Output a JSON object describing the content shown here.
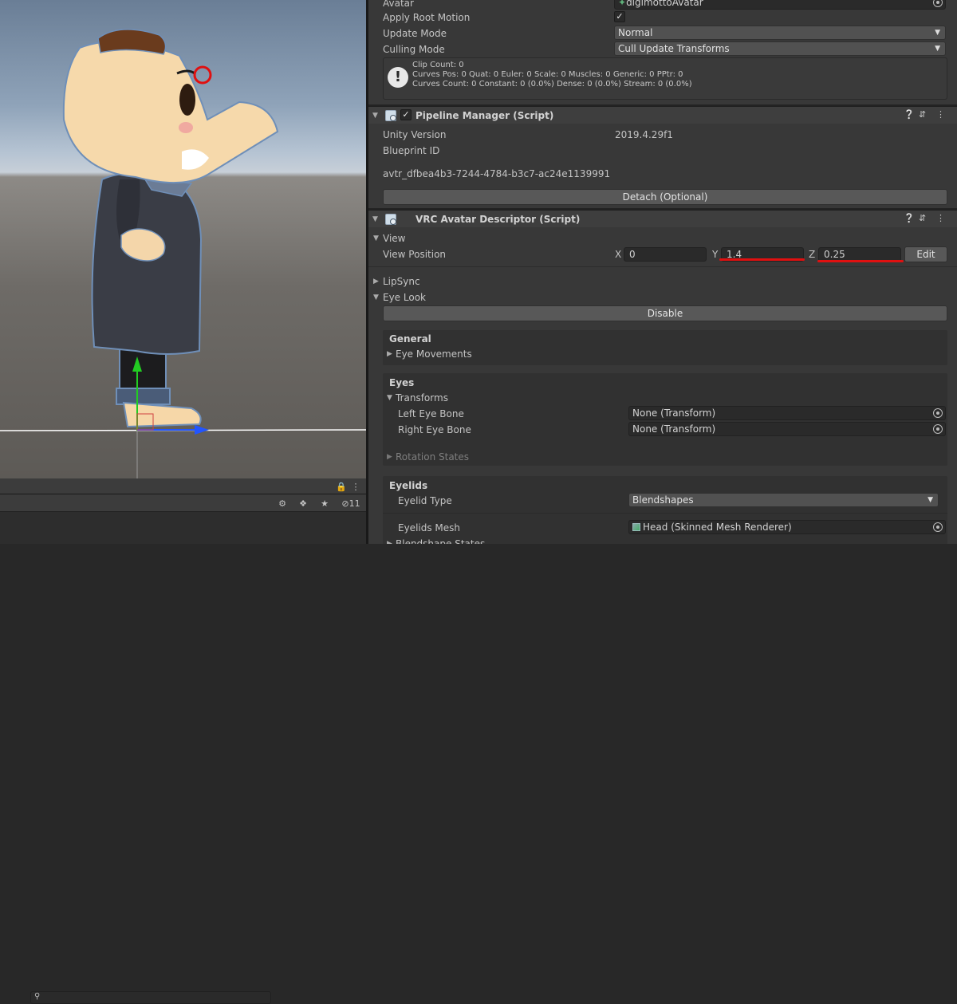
{
  "inspector": {
    "animator": {
      "avatar_label": "Avatar",
      "avatar_value": "digimottoAvatar",
      "apply_root_motion_label": "Apply Root Motion",
      "apply_root_motion_checked": true,
      "update_mode_label": "Update Mode",
      "update_mode_value": "Normal",
      "culling_mode_label": "Culling Mode",
      "culling_mode_value": "Cull Update Transforms",
      "info_lines": [
        "Clip Count: 0",
        "Curves Pos: 0 Quat: 0 Euler: 0 Scale: 0 Muscles: 0 Generic: 0 PPtr: 0",
        "Curves Count: 0 Constant: 0 (0.0%) Dense: 0 (0.0%) Stream: 0 (0.0%)"
      ]
    },
    "pipeline": {
      "title": "Pipeline Manager (Script)",
      "unity_version_label": "Unity Version",
      "unity_version_value": "2019.4.29f1",
      "blueprint_id_label": "Blueprint ID",
      "blueprint_id_value": "avtr_dfbea4b3-7244-4784-b3c7-ac24e1139991",
      "detach_button": "Detach (Optional)"
    },
    "descriptor": {
      "title": "VRC Avatar Descriptor (Script)",
      "view_label": "View",
      "view_position_label": "View Position",
      "x_label": "X",
      "x_value": "0",
      "y_label": "Y",
      "y_value": "1.4",
      "z_label": "Z",
      "z_value": "0.25",
      "edit_button": "Edit",
      "lipsync_label": "LipSync",
      "eye_look_label": "Eye Look",
      "disable_button": "Disable",
      "general_heading": "General",
      "eye_movements_label": "Eye Movements",
      "eyes_heading": "Eyes",
      "transforms_label": "Transforms",
      "left_eye_label": "Left Eye Bone",
      "left_eye_value": "None (Transform)",
      "right_eye_label": "Right Eye Bone",
      "right_eye_value": "None (Transform)",
      "rotation_states_label": "Rotation States",
      "eyelids_heading": "Eyelids",
      "eyelid_type_label": "Eyelid Type",
      "eyelid_type_value": "Blendshapes",
      "eyelids_mesh_label": "Eyelids Mesh",
      "eyelids_mesh_value": "Head (Skinned Mesh Renderer)",
      "blendshape_states_label": "Blendshape States"
    }
  },
  "hierarchy": {
    "search_placeholder": "",
    "hidden_count": "11"
  },
  "colors": {
    "highlight_red": "#e01010",
    "axis_y_green": "#22cc22",
    "axis_z_blue": "#2255ff"
  }
}
